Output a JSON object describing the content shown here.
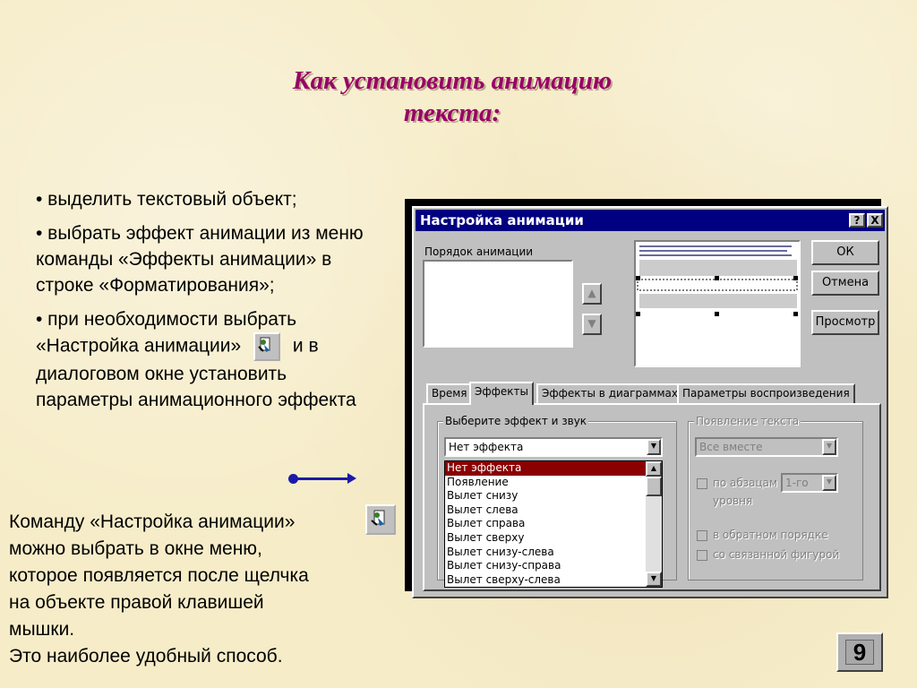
{
  "slide": {
    "title_line1": "Как установить  анимацию",
    "title_line2": "текста:",
    "bullets": [
      "• выделить текстовый объект;",
      "• выбрать эффект анимации из меню команды «Эффекты анимации» в строке «Форматирования»;",
      "• при необходимости выбрать «Настройка анимации»",
      "и в диалоговом окне установить параметры анимационного эффекта"
    ],
    "note_lines": [
      "Команду «Настройка анимации»",
      "можно выбрать в окне меню,",
      "которое появляется после щелчка",
      "на объекте правой клавишей",
      "мышки.",
      "Это наиболее удобный способ."
    ],
    "page_number": "9",
    "icon": "custom-animation-icon"
  },
  "dialog": {
    "title": "Настройка анимации",
    "help_btn": "?",
    "close_btn": "X",
    "order_label": "Порядок анимации",
    "ok": "ОК",
    "cancel": "Отмена",
    "preview": "Просмотр",
    "tabs": [
      "Время",
      "Эффекты",
      "Эффекты в диаграммах",
      "Параметры воспроизведения"
    ],
    "effect_group_label": "Выберите эффект и звук",
    "effect_selected": "Нет эффекта",
    "effect_options": [
      "Нет эффекта",
      "Появление",
      "Вылет снизу",
      "Вылет слева",
      "Вылет справа",
      "Вылет сверху",
      "Вылет снизу-слева",
      "Вылет снизу-справа",
      "Вылет сверху-слева"
    ],
    "text_group_label": "Появление текста",
    "text_combo": "Все вместе",
    "by_paragraph": "по абзацам",
    "level_combo": "1-го",
    "level_label": "уровня",
    "reverse_order": "в обратном порядке",
    "attached_shape": "со связанной фигурой"
  }
}
